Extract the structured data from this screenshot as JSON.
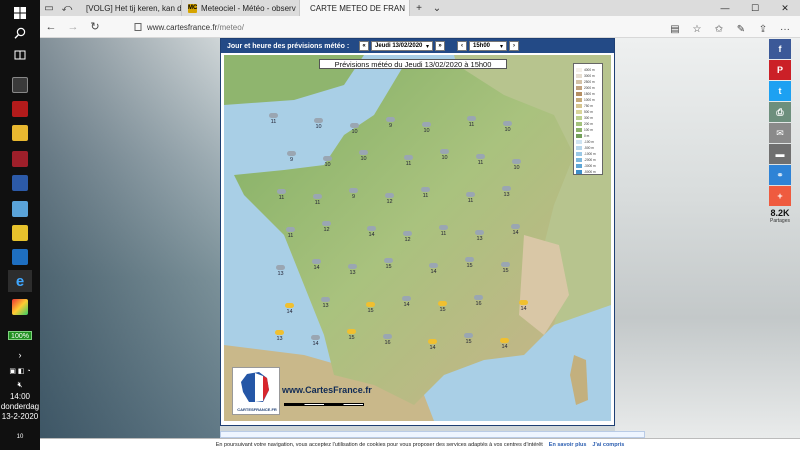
{
  "taskbar": {
    "battery": "100%",
    "time": "14:00",
    "day": "donderdag",
    "date": "13-2-2020",
    "notification_count": "10"
  },
  "tabs": [
    {
      "title": "[VOLG] Het tij keren, kan da",
      "favicon": "page-icon"
    },
    {
      "title": "Meteociel - Météo - observ",
      "favicon": "mc-icon",
      "favicon_text": "MC"
    },
    {
      "title": "CARTE METEO DE FRAN",
      "favicon": "cartesfrance-icon",
      "active": true
    }
  ],
  "address": {
    "host": "www.cartesfrance.fr",
    "path": "/meteo/"
  },
  "panel": {
    "header_label": "Jour et heure des prévisions météo :",
    "date_select": "Jeudi 13/02/2020",
    "time_select": "15h00"
  },
  "map": {
    "title": "Prévisions météo du Jeudi 13/02/2020 à 15h00",
    "brand": "www.CartesFrance.fr",
    "logo_caption": "CARTESFRANCE.FR",
    "legend": [
      {
        "label": "4000 m",
        "color": "#f5f0ea"
      },
      {
        "label": "3000 m",
        "color": "#e6ddd0"
      },
      {
        "label": "2500 m",
        "color": "#d4c2a8"
      },
      {
        "label": "2000 m",
        "color": "#c2a27e"
      },
      {
        "label": "1500 m",
        "color": "#b48e62"
      },
      {
        "label": "1000 m",
        "color": "#c6ab7a"
      },
      {
        "label": "750 m",
        "color": "#d6c58e"
      },
      {
        "label": "500 m",
        "color": "#d9d59a"
      },
      {
        "label": "300 m",
        "color": "#bcd08e"
      },
      {
        "label": "200 m",
        "color": "#a3c27c"
      },
      {
        "label": "100 m",
        "color": "#8db36b"
      },
      {
        "label": "0 m",
        "color": "#73a05a"
      },
      {
        "label": "-100 m",
        "color": "#cfe4f2"
      },
      {
        "label": "-500 m",
        "color": "#b6d6ec"
      },
      {
        "label": "-1000 m",
        "color": "#9ac8e6"
      },
      {
        "label": "-2000 m",
        "color": "#7db8de"
      },
      {
        "label": "-3000 m",
        "color": "#5ea6d6"
      },
      {
        "label": "-5000 m",
        "color": "#3e8fc9"
      }
    ],
    "temperatures": [
      "11",
      "10",
      "10",
      "9",
      "10",
      "11",
      "10",
      "9",
      "10",
      "10",
      "11",
      "10",
      "11",
      "10",
      "11",
      "11",
      "9",
      "12",
      "11",
      "11",
      "13",
      "11",
      "12",
      "14",
      "12",
      "11",
      "13",
      "14",
      "13",
      "14",
      "13",
      "15",
      "14",
      "15",
      "15",
      "14",
      "13",
      "15",
      "14",
      "15",
      "16",
      "14",
      "13",
      "14",
      "15",
      "16",
      "14",
      "15",
      "14"
    ]
  },
  "social": {
    "count": "8.2K",
    "label": "Partages",
    "buttons": [
      "f",
      "P",
      "t",
      "print",
      "m",
      "e",
      "link",
      "+"
    ]
  },
  "cookie": {
    "text": "En poursuivant votre navigation, vous acceptez l'utilisation de cookies pour vous proposer des services adaptés à vos centres d'intérêt",
    "more": "En savoir plus",
    "accept": "J'ai compris"
  }
}
